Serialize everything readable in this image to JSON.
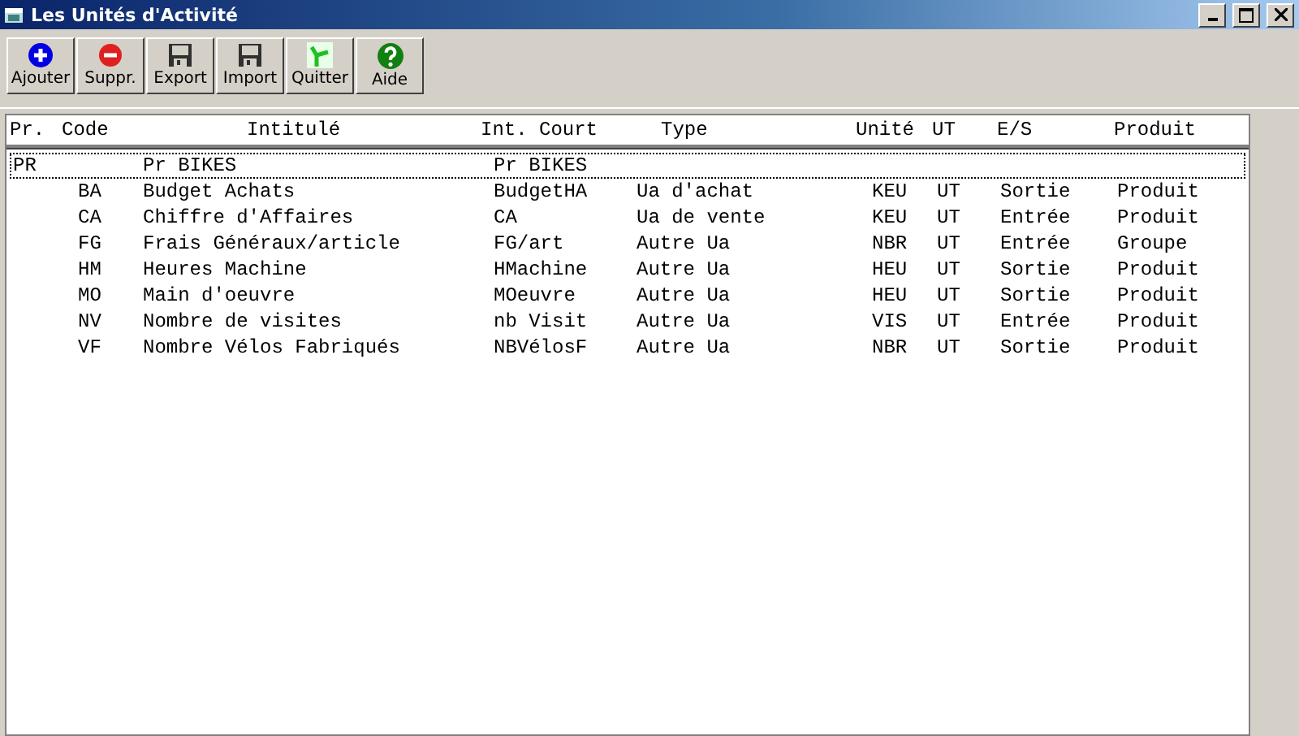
{
  "window": {
    "title": "Les Unités d'Activité"
  },
  "toolbar": [
    {
      "kind": "add",
      "label": "Ajouter"
    },
    {
      "kind": "delete",
      "label": "Suppr."
    },
    {
      "kind": "save",
      "label": "Export"
    },
    {
      "kind": "save",
      "label": "Import"
    },
    {
      "kind": "exit",
      "label": "Quitter"
    },
    {
      "kind": "help",
      "label": "Aide"
    }
  ],
  "table": {
    "columns": [
      "Pr.",
      "Code",
      "Intitulé",
      "Int. Court",
      "Type",
      "Unité",
      "UT",
      "E/S",
      "Produit"
    ],
    "rows": [
      {
        "pr": "PR",
        "intitule": "Pr BIKES",
        "court": "Pr BIKES",
        "selected": true
      },
      {
        "code": "BA",
        "intitule": "Budget Achats",
        "court": "BudgetHA",
        "type": "Ua d'achat",
        "unite": "KEU",
        "ut": "UT",
        "es": "Sortie",
        "produit": "Produit",
        "selected": false
      },
      {
        "code": "CA",
        "intitule": "Chiffre d'Affaires",
        "court": "CA",
        "type": "Ua de vente",
        "unite": "KEU",
        "ut": "UT",
        "es": "Entrée",
        "produit": "Produit",
        "selected": false
      },
      {
        "code": "FG",
        "intitule": "Frais Généraux/article",
        "court": "FG/art",
        "type": "Autre Ua",
        "unite": "NBR",
        "ut": "UT",
        "es": "Entrée",
        "produit": "Groupe",
        "selected": false
      },
      {
        "code": "HM",
        "intitule": "Heures Machine",
        "court": "HMachine",
        "type": "Autre Ua",
        "unite": "HEU",
        "ut": "UT",
        "es": "Sortie",
        "produit": "Produit",
        "selected": false
      },
      {
        "code": "MO",
        "intitule": "Main d'oeuvre",
        "court": "MOeuvre",
        "type": "Autre Ua",
        "unite": "HEU",
        "ut": "UT",
        "es": "Sortie",
        "produit": "Produit",
        "selected": false
      },
      {
        "code": "NV",
        "intitule": "Nombre de visites",
        "court": "nb Visit",
        "type": "Autre Ua",
        "unite": "VIS",
        "ut": "UT",
        "es": "Entrée",
        "produit": "Produit",
        "selected": false
      },
      {
        "code": "VF",
        "intitule": "Nombre Vélos Fabriqués",
        "court": "NBVélosF",
        "type": "Autre Ua",
        "unite": "NBR",
        "ut": "UT",
        "es": "Sortie",
        "produit": "Produit",
        "selected": false
      }
    ]
  }
}
